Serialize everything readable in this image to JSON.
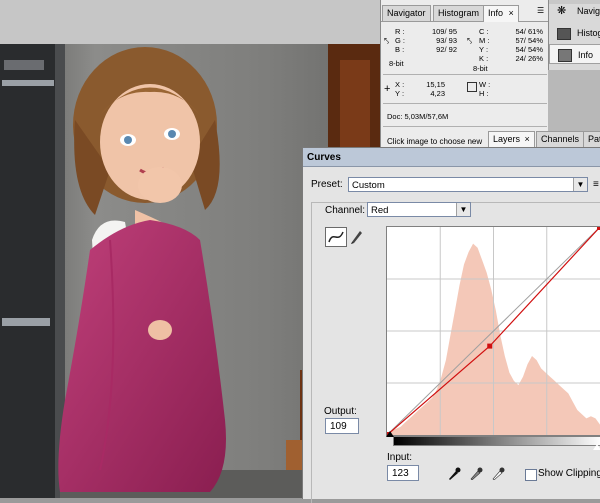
{
  "colors": {
    "accent_red": "#d01010",
    "histogram_fill": "#f4c8b8",
    "title_bar": "#bcc8d8"
  },
  "info_panel": {
    "tabs": [
      {
        "label": "Navigator",
        "active": false
      },
      {
        "label": "Histogram",
        "active": false
      },
      {
        "label": "Info",
        "active": true
      }
    ],
    "close_glyph": "×",
    "rgb": {
      "r_label": "R :",
      "r_value": "109/  95",
      "g_label": "G :",
      "g_value": "93/  93",
      "b_label": "B :",
      "b_value": "92/  92",
      "bit": "8-bit"
    },
    "cmyk": {
      "c_label": "C :",
      "c_value": "54/  61%",
      "m_label": "M :",
      "m_value": "57/  54%",
      "y_label": "Y :",
      "y_value": "54/  54%",
      "k_label": "K :",
      "k_value": "24/  26%",
      "bit": "8-bit"
    },
    "xy": {
      "x_label": "X :",
      "x_value": "15,15",
      "y_label": "Y :",
      "y_value": "4,23"
    },
    "wh": {
      "w_label": "W :",
      "h_label": "H :"
    },
    "doc": "Doc: 5,03M/57,6M",
    "hint": "Click image to choose new"
  },
  "dock": {
    "items": [
      {
        "label": "Navigat",
        "icon": "navigator-icon"
      },
      {
        "label": "Histog",
        "icon": "histogram-icon"
      },
      {
        "label": "Info",
        "icon": "info-icon"
      }
    ]
  },
  "layers_tabs": [
    {
      "label": "Layers"
    },
    {
      "label": "Channels"
    },
    {
      "label": "Pat"
    }
  ],
  "curves": {
    "title": "Curves",
    "preset_label": "Preset:",
    "preset_value": "Custom",
    "channel_label": "Channel:",
    "channel_value": "Red",
    "output_label": "Output:",
    "output_value": "109",
    "input_label": "Input:",
    "input_value": "123",
    "show_clipping_label": "Show Clipping",
    "control_point": {
      "input": 123,
      "output": 109
    }
  }
}
